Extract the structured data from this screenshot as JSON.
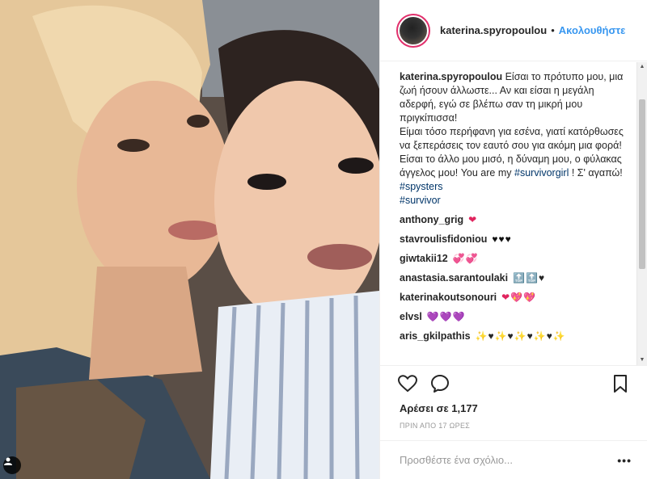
{
  "header": {
    "username": "katerina.spyropoulou",
    "separator": "•",
    "follow_label": "Ακολουθήστε"
  },
  "caption": {
    "username": "katerina.spyropoulou",
    "line1": "Είσαι το πρότυπο μου, μια ζωή ήσουν άλλωστε... Αν και είσαι η μεγάλη αδερφή, εγώ σε βλέπω σαν τη μικρή μου πριγκίπισσα!",
    "line2": "Είμαι τόσο περήφανη για εσένα, γιατί κατόρθωσες να ξεπεράσεις τον εαυτό σου για ακόμη μια φορά!",
    "line3_start": "Είσαι το άλλο μου μισό, η δύναμη μου, ο φύλακας άγγελος μου! You are my",
    "tag1": "#survivorgirl",
    "mid": " ! Σ' αγαπώ! ",
    "tag2": "#spysters",
    "tag3": "#survivor"
  },
  "comments": [
    {
      "user": "anthony_grig",
      "emoji": "❤"
    },
    {
      "user": "stavroulisfidoniou",
      "emoji": "♥♥♥"
    },
    {
      "user": "giwtakii12",
      "emoji": "💞💞"
    },
    {
      "user": "anastasia.sarantoulaki",
      "emoji": "🔝🔝♥"
    },
    {
      "user": "katerinakoutsonouri",
      "emoji": "❤💖💖"
    },
    {
      "user": "elvsl",
      "emoji": "💜💜💜"
    },
    {
      "user": "aris_gkilpathis",
      "emoji": "✨♥✨♥✨♥✨♥✨"
    }
  ],
  "actions": {
    "like_icon": "heart-outline-icon",
    "comment_icon": "comment-bubble-icon",
    "save_icon": "bookmark-icon"
  },
  "likes_text": "Αρέσει σε 1,177",
  "timestamp": "ΠΡΙΝ ΑΠΟ 17 ΩΡΕΣ",
  "add_comment": {
    "placeholder": "Προσθέστε ένα σχόλιο...",
    "more_label": "•••"
  },
  "colors": {
    "link_blue": "#3897f0",
    "hashtag": "#003569",
    "heart_red": "#e0245e",
    "border": "#efefef"
  }
}
